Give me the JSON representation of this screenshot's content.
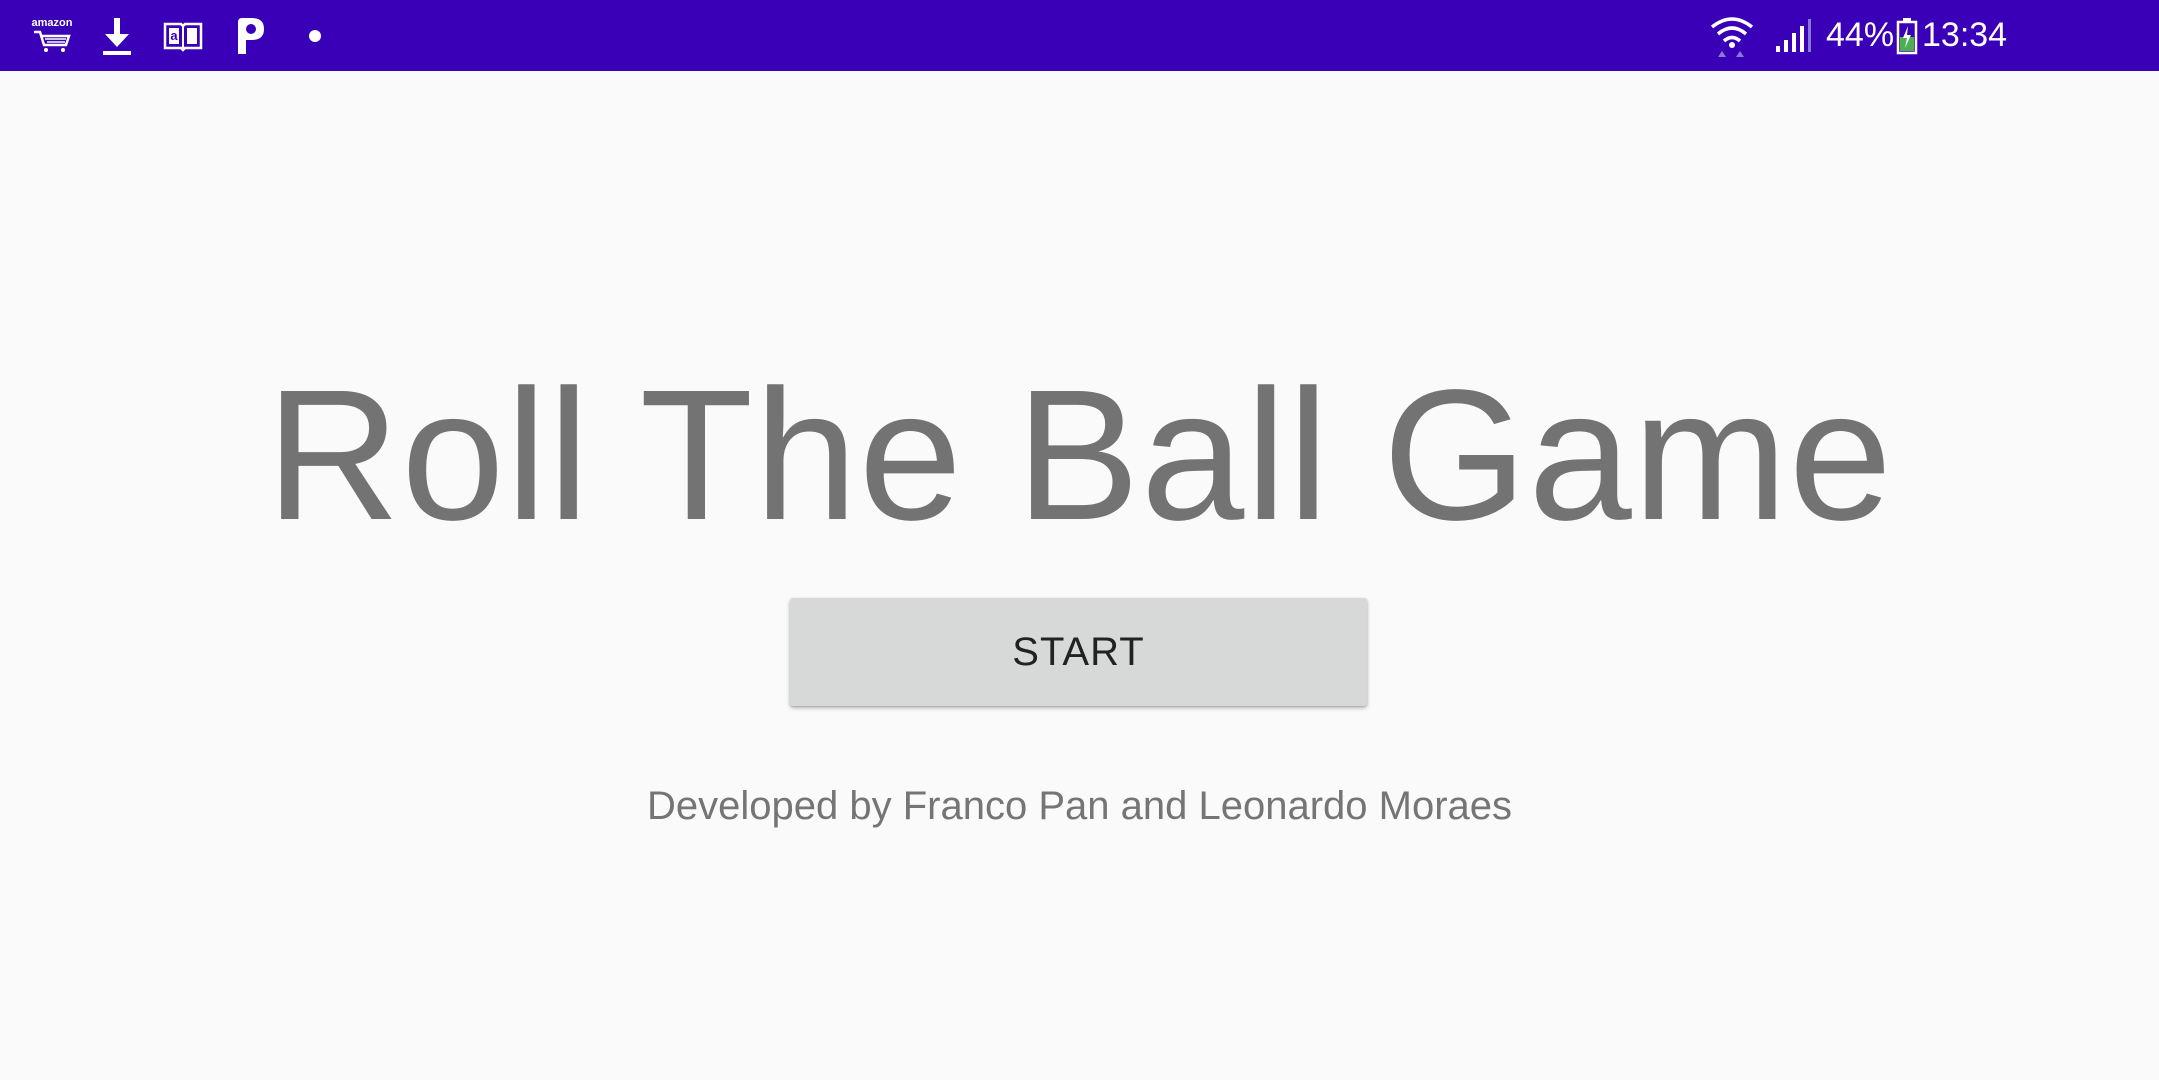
{
  "status_bar": {
    "background_color": "#3a00b8",
    "notification_icons": [
      "amazon-shopping-icon",
      "download-icon",
      "amazon-kindle-icon",
      "parking-app-icon",
      "dot-icon"
    ],
    "amazon_label": "amazon",
    "kindle_letter": "a",
    "parking_letter": "P",
    "wifi_icon": "wifi-icon",
    "signal_icon": "cell-signal-icon",
    "battery_percent": "44%",
    "battery_icon": "battery-charging-icon",
    "battery_charge_color": "#4caf50",
    "time": "13:34"
  },
  "main": {
    "title": "Roll The Ball Game",
    "start_button_label": "START",
    "credits": "Developed by Franco Pan and Leonardo Moraes"
  }
}
